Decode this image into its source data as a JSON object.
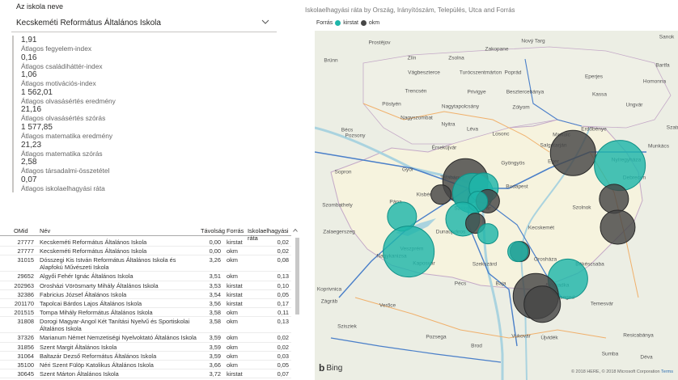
{
  "slicer": {
    "title": "Az iskola neve",
    "value": "Kecskeméti Református Általános Iskola"
  },
  "kpis": [
    {
      "value": "1,91",
      "label": "Átlagos fegyelem-index"
    },
    {
      "value": "0,16",
      "label": "Átlagos családiháttér-index"
    },
    {
      "value": "1,06",
      "label": "Átlagos motivációs-index"
    },
    {
      "value": "1 562,01",
      "label": "Átlagos olvasásértés eredmény"
    },
    {
      "value": "21,16",
      "label": "Átlagos olvasásértés szórás"
    },
    {
      "value": "1 577,85",
      "label": "Átlagos matematika eredmény"
    },
    {
      "value": "21,23",
      "label": "Átlagos matematika szórás"
    },
    {
      "value": "2,58",
      "label": "Átlagos társadalmi-összetétel"
    },
    {
      "value": "0,07",
      "label": "Átlagos iskolaelhagyási ráta"
    }
  ],
  "table": {
    "headers": {
      "omid": "OMid",
      "nev": "Név",
      "tav": "Távolság",
      "forras": "Forrás",
      "rata": "Iskolaelhagyási ráta"
    },
    "rows": [
      {
        "omid": "27777",
        "nev": "Kecskeméti Református Általános Iskola",
        "tav": "0,00",
        "forras": "kirstat",
        "rata": "0,02"
      },
      {
        "omid": "27777",
        "nev": "Kecskeméti Református Általános Iskola",
        "tav": "0,00",
        "forras": "okm",
        "rata": "0,02"
      },
      {
        "omid": "31015",
        "nev": "Dósszegi Kis István Református Általános Iskola és Alapfokú Művészeti Iskola",
        "tav": "3,26",
        "forras": "okm",
        "rata": "0,08"
      },
      {
        "omid": "29652",
        "nev": "Algyői Fehér Ignác Általános Iskola",
        "tav": "3,51",
        "forras": "okm",
        "rata": "0,13"
      },
      {
        "omid": "202963",
        "nev": "Orosházi Vörösmarty Mihály Általános Iskola",
        "tav": "3,53",
        "forras": "kirstat",
        "rata": "0,10"
      },
      {
        "omid": "32386",
        "nev": "Fabricius József Általános Iskola",
        "tav": "3,54",
        "forras": "kirstat",
        "rata": "0,05"
      },
      {
        "omid": "201170",
        "nev": "Tapolcai Bárdos Lajos Általános Iskola",
        "tav": "3,56",
        "forras": "kirstat",
        "rata": "0,17"
      },
      {
        "omid": "201515",
        "nev": "Tompa Mihály Református Általános Iskola",
        "tav": "3,58",
        "forras": "okm",
        "rata": "0,11"
      },
      {
        "omid": "31808",
        "nev": "Dorogi Magyar-Angol Két Tanítási Nyelvű és Sportiskolai Általános Iskola",
        "tav": "3,58",
        "forras": "okm",
        "rata": "0,13"
      },
      {
        "omid": "37326",
        "nev": "Marianum Német Nemzetiségi Nyelvoktató Általános Iskola",
        "tav": "3,59",
        "forras": "okm",
        "rata": "0,02"
      },
      {
        "omid": "31856",
        "nev": "Szent Margit Általános Iskola",
        "tav": "3,59",
        "forras": "okm",
        "rata": "0,02"
      },
      {
        "omid": "31064",
        "nev": "Baltazár Dezső Református Általános Iskola",
        "tav": "3,59",
        "forras": "okm",
        "rata": "0,03"
      },
      {
        "omid": "35100",
        "nev": "Néri Szent Fülöp Katolikus Általános Iskola",
        "tav": "3,66",
        "forras": "okm",
        "rata": "0,05"
      },
      {
        "omid": "30645",
        "nev": "Szent Márton Általános Iskola",
        "tav": "3,72",
        "forras": "kirstat",
        "rata": "0,07"
      }
    ]
  },
  "map": {
    "title": "Iskolaelhagyási ráta by Ország, Irányítószám, Település, Utca and Forrás",
    "legend": {
      "title": "Forrás",
      "items": [
        {
          "name": "kirstat",
          "color": "#1fb6aa"
        },
        {
          "name": "okm",
          "color": "#464646"
        }
      ]
    },
    "bing": "Bing",
    "copyright": "© 2018 HERE, © 2018 Microsoft Corporation",
    "terms": "Terms",
    "places": [
      "Nový Targ",
      "Sanok",
      "Zakopane",
      "Bartfa",
      "Prostějov",
      "Zlín",
      "Zsolna",
      "Brünn",
      "Vágbeszterce",
      "Turócszentmárton",
      "Poprád",
      "Eperjes",
      "Homonna",
      "Trencsén",
      "Privigye",
      "Besztercebánya",
      "Kassa",
      "Ungvár",
      "Pöstyén",
      "Nagytapolcsány",
      "Zólyom",
      "Nagyszombat",
      "Nyitra",
      "Léva",
      "Losonc",
      "Miskolc",
      "Erdőbénye",
      "Munkács",
      "Bécs",
      "Pozsony",
      "Érsekújvár",
      "Salgótarján",
      "Eger",
      "Nyíregyháza",
      "Győr",
      "Gyöngyös",
      "Debrecen",
      "Sopron",
      "Tatabánya",
      "Budapest",
      "Kisbér",
      "Szombathely",
      "Pápa",
      "Székesfehérvár",
      "Szolnok",
      "Zalaegerszeg",
      "Veszprém",
      "Dunaújváros",
      "Kecskemét",
      "Nagykanizsa",
      "Kaposvár",
      "Szekszárd",
      "Orosháza",
      "Békéscsaba",
      "Koprivnica",
      "Pécs",
      "Baja",
      "Szabadka",
      "Szeged",
      "Zágráb",
      "Verőce",
      "Temesvár",
      "Szisziek",
      "Pozsega",
      "Vukovár",
      "Újvidék",
      "Resicabánya",
      "Brod",
      "Sumba",
      "Déva",
      "Szatm"
    ],
    "points": [
      {
        "lat": 48.1,
        "lon": 20.78,
        "forras": "okm",
        "rata": 0.13
      },
      {
        "lat": 47.95,
        "lon": 21.72,
        "forras": "kirstat",
        "rata": 0.17
      },
      {
        "lat": 47.55,
        "lon": 21.6,
        "forras": "okm",
        "rata": 0.05
      },
      {
        "lat": 47.76,
        "lon": 18.6,
        "forras": "okm",
        "rata": 0.13
      },
      {
        "lat": 47.62,
        "lon": 18.75,
        "forras": "kirstat",
        "rata": 0.1
      },
      {
        "lat": 47.68,
        "lon": 18.97,
        "forras": "kirstat",
        "rata": 0.05
      },
      {
        "lat": 47.52,
        "lon": 19.05,
        "forras": "okm",
        "rata": 0.03
      },
      {
        "lat": 47.6,
        "lon": 18.1,
        "forras": "okm",
        "rata": 0.02
      },
      {
        "lat": 47.52,
        "lon": 18.85,
        "forras": "kirstat",
        "rata": 0.02
      },
      {
        "lat": 47.3,
        "lon": 18.55,
        "forras": "kirstat",
        "rata": 0.07
      },
      {
        "lat": 47.25,
        "lon": 18.8,
        "forras": "okm",
        "rata": 0.02
      },
      {
        "lat": 47.12,
        "lon": 19.05,
        "forras": "kirstat",
        "rata": 0.02
      },
      {
        "lat": 47.33,
        "lon": 17.32,
        "forras": "kirstat",
        "rata": 0.05
      },
      {
        "lat": 46.9,
        "lon": 17.45,
        "forras": "kirstat",
        "rata": 0.17
      },
      {
        "lat": 46.9,
        "lon": 19.7,
        "forras": "okm",
        "rata": 0.02
      },
      {
        "lat": 46.9,
        "lon": 19.66,
        "forras": "kirstat",
        "rata": 0.02
      },
      {
        "lat": 46.57,
        "lon": 20.67,
        "forras": "kirstat",
        "rata": 0.1
      },
      {
        "lat": 46.35,
        "lon": 20.02,
        "forras": "okm",
        "rata": 0.13
      },
      {
        "lat": 46.25,
        "lon": 20.15,
        "forras": "okm",
        "rata": 0.08
      },
      {
        "lat": 47.2,
        "lon": 21.68,
        "forras": "okm",
        "rata": 0.07
      }
    ]
  }
}
